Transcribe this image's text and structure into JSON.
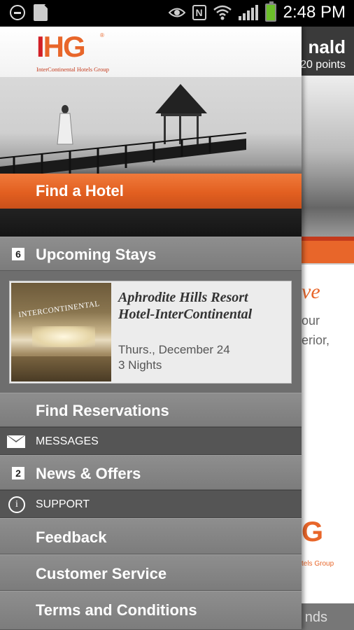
{
  "status_bar": {
    "time": "2:48 PM",
    "icons": [
      "do-not-disturb-icon",
      "sd-card-icon",
      "eye-icon",
      "nfc-icon",
      "wifi-icon",
      "signal-icon",
      "battery-icon"
    ],
    "nfc_letter": "N"
  },
  "background_page": {
    "name_fragment": "nald",
    "points_fragment": "20 points",
    "heading_fragment": "ve",
    "text_line1_fragment": "our",
    "text_line2_fragment": "erior,",
    "logo_fragment": "G",
    "logo_sub_fragment": "tels Group",
    "footer_fragment": "nds"
  },
  "drawer": {
    "logo": {
      "i": "I",
      "h": "H",
      "g": "G",
      "registered": "®",
      "subtitle": "InterContinental Hotels Group"
    },
    "find_hotel": "Find a Hotel",
    "upcoming_stays": {
      "count": "6",
      "label": "Upcoming Stays"
    },
    "stay": {
      "photo_sign": "INTERCONTINENTAL",
      "name_line1": "Aphrodite Hills Resort",
      "name_line2": "Hotel-InterContinental",
      "date": "Thurs., December 24",
      "nights": "3 Nights"
    },
    "find_reservations": "Find Reservations",
    "messages": "MESSAGES",
    "news_offers": {
      "count": "2",
      "label": "News & Offers"
    },
    "support": "SUPPORT",
    "support_icon_glyph": "i",
    "feedback": "Feedback",
    "customer_service": "Customer Service",
    "terms": "Terms and Conditions"
  },
  "colors": {
    "accent_orange": "#e8662a",
    "brand_red": "#d22027",
    "drawer_gray": "#7a7a7a",
    "section_dark": "#555555"
  }
}
